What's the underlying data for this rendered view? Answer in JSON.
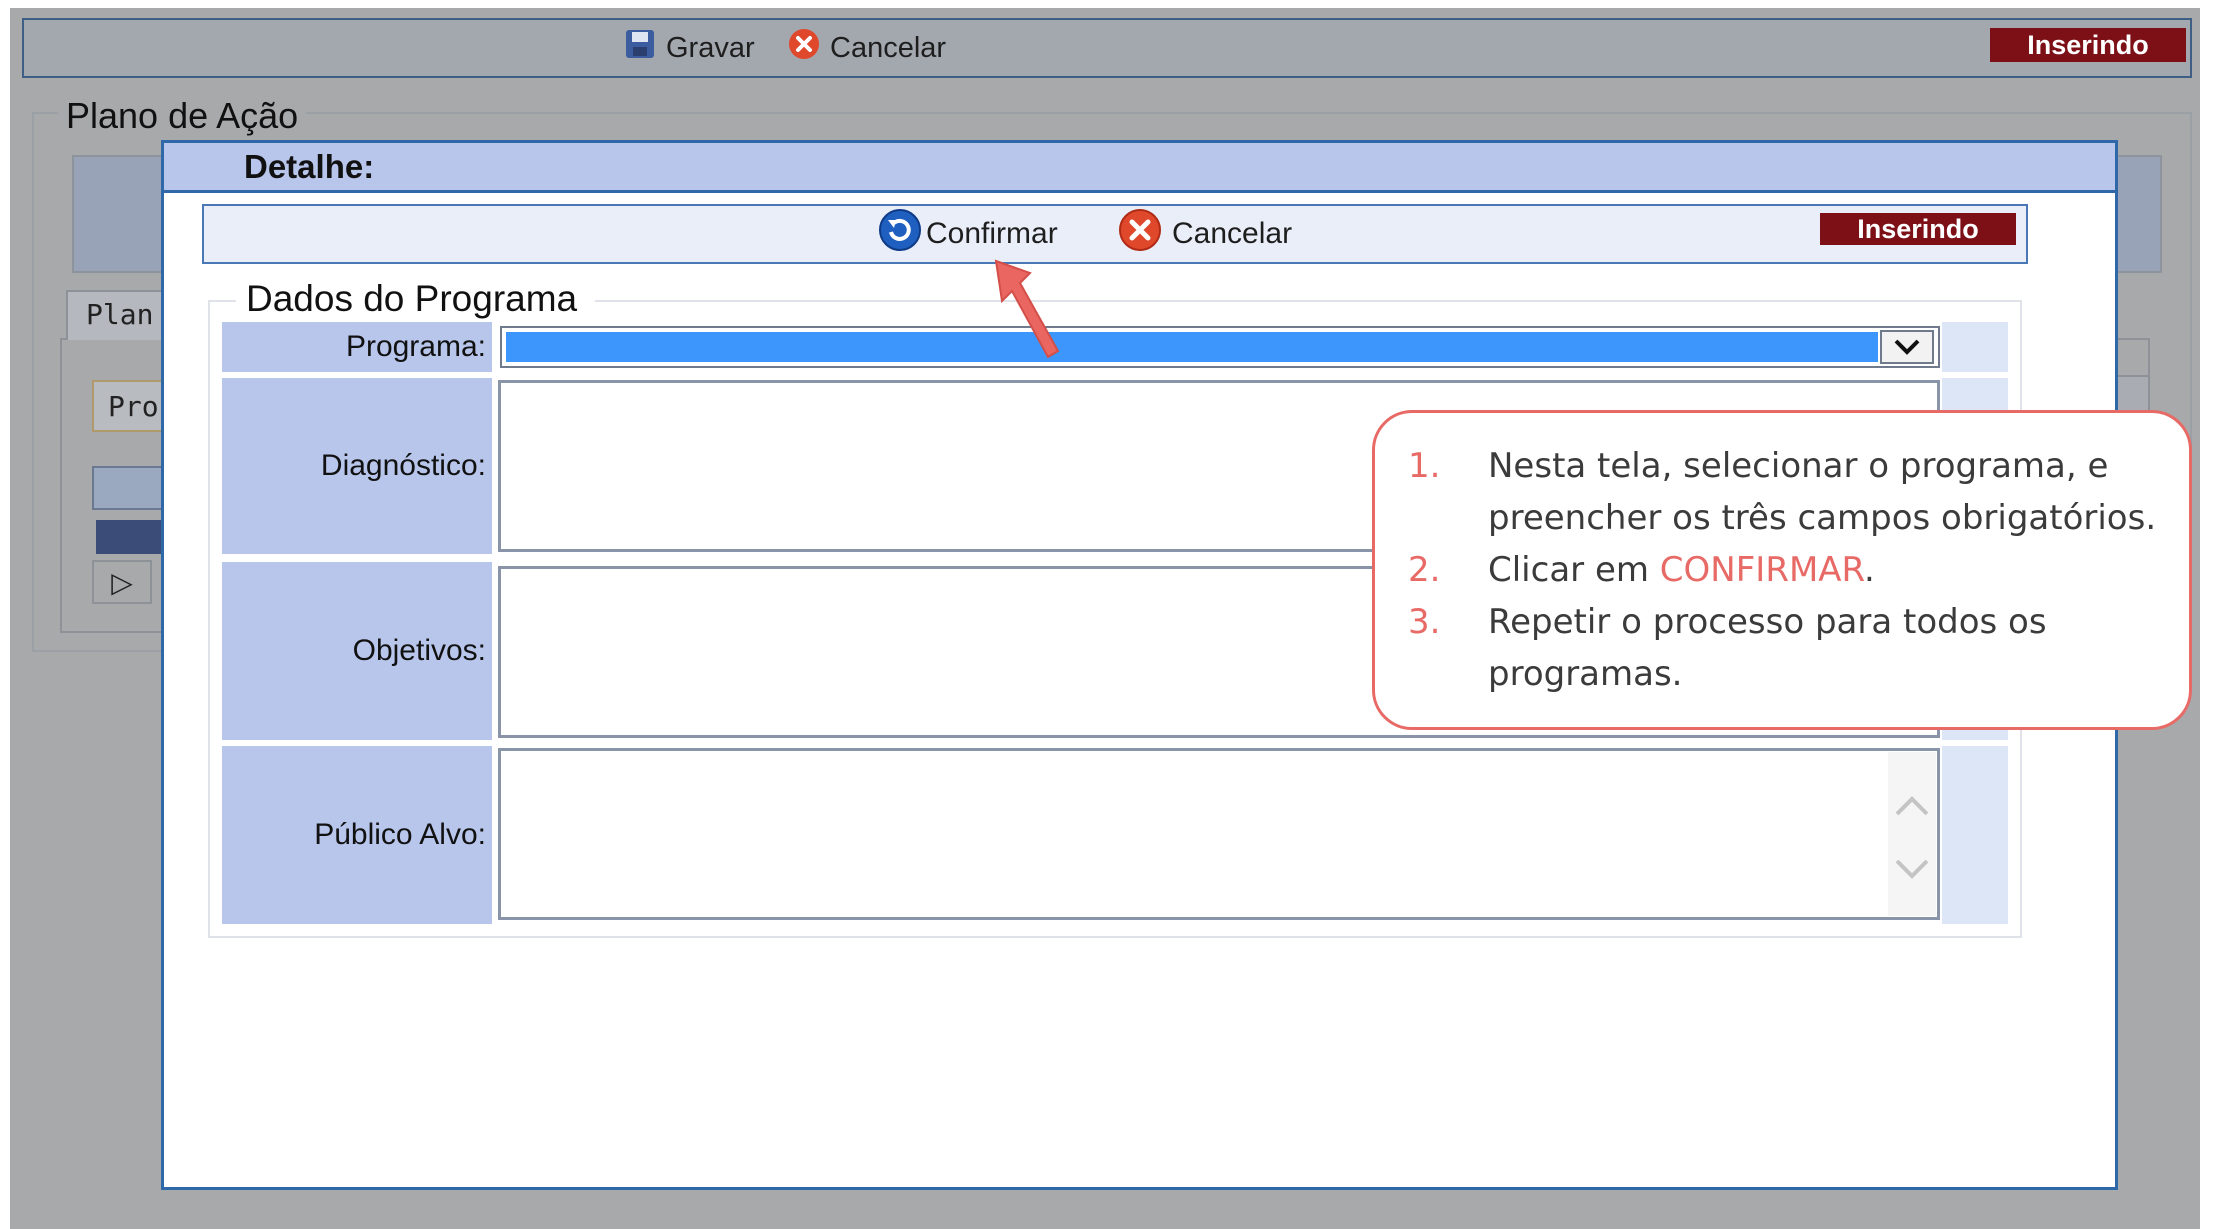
{
  "background_window": {
    "toolbar": {
      "save_label": "Gravar",
      "cancel_label": "Cancelar",
      "status": "Inserindo"
    },
    "section_title": "Plano de Ação",
    "tab_label": "Plan",
    "subtab_label": "Pro"
  },
  "modal": {
    "title": "Detalhe:",
    "toolbar": {
      "confirm_label": "Confirmar",
      "cancel_label": "Cancelar",
      "status": "Inserindo"
    },
    "fieldset_legend": "Dados do Programa",
    "fields": {
      "programa": {
        "label": "Programa:",
        "value": ""
      },
      "diagnostico": {
        "label": "Diagnóstico:",
        "value": ""
      },
      "objetivos": {
        "label": "Objetivos:",
        "value": ""
      },
      "publico_alvo": {
        "label": "Público Alvo:",
        "value": ""
      }
    }
  },
  "callout": {
    "items": [
      {
        "number": "1.",
        "text": "Nesta tela, selecionar o programa, e preencher os três campos obrigatórios."
      },
      {
        "number": "2.",
        "text_before": "Clicar em ",
        "highlight": "CONFIRMAR",
        "text_after": "."
      },
      {
        "number": "3.",
        "text": "Repetir o processo para todos os programas."
      }
    ]
  },
  "colors": {
    "status_badge": "#7d1017",
    "modal_border": "#2e68a8",
    "label_background": "#b8c6ec",
    "callout_accent": "#e86a66",
    "select_highlight": "#3d96fb"
  },
  "icons": [
    "save-icon",
    "cancel-icon",
    "confirm-icon",
    "chevron-down-icon",
    "play-icon",
    "scroll-up-icon",
    "scroll-down-icon",
    "arrow-pointer-icon"
  ]
}
